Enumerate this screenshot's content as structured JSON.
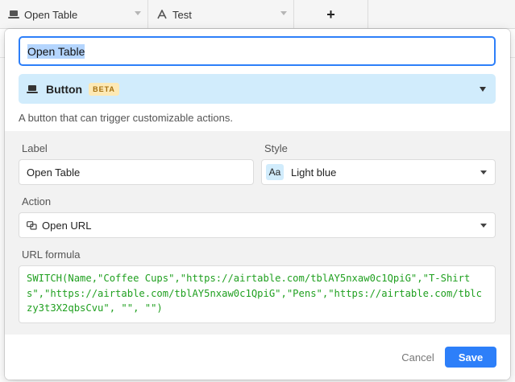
{
  "grid": {
    "columns": [
      {
        "label": "Open Table",
        "icon": "laptop-icon"
      },
      {
        "label": "Test",
        "icon": "text-field-icon"
      }
    ],
    "add_column_label": "+"
  },
  "field_editor": {
    "name_value": "Open Table",
    "type": {
      "label": "Button",
      "badge": "BETA",
      "icon": "laptop-icon"
    },
    "type_description": "A button that can trigger customizable actions.",
    "label_field": {
      "label": "Label",
      "value": "Open Table"
    },
    "style_field": {
      "label": "Style",
      "swatch_text": "Aa",
      "value": "Light blue",
      "swatch_color": "#d1ecfc"
    },
    "action_field": {
      "label": "Action",
      "value": "Open URL"
    },
    "url_formula": {
      "label": "URL formula",
      "value": "SWITCH(Name,\"Coffee Cups\",\"https://airtable.com/tblAY5nxaw0c1QpiG\",\"T-Shirts\",\"https://airtable.com/tblAY5nxaw0c1QpiG\",\"Pens\",\"https://airtable.com/tblczy3t3X2qbsCvu\", \"\", \"\")"
    },
    "cancel_label": "Cancel",
    "save_label": "Save"
  },
  "colors": {
    "accent": "#2d7ff9",
    "type_select_bg": "#d1ecfc",
    "beta_bg": "#fde9b5",
    "formula_text": "#20a020"
  }
}
